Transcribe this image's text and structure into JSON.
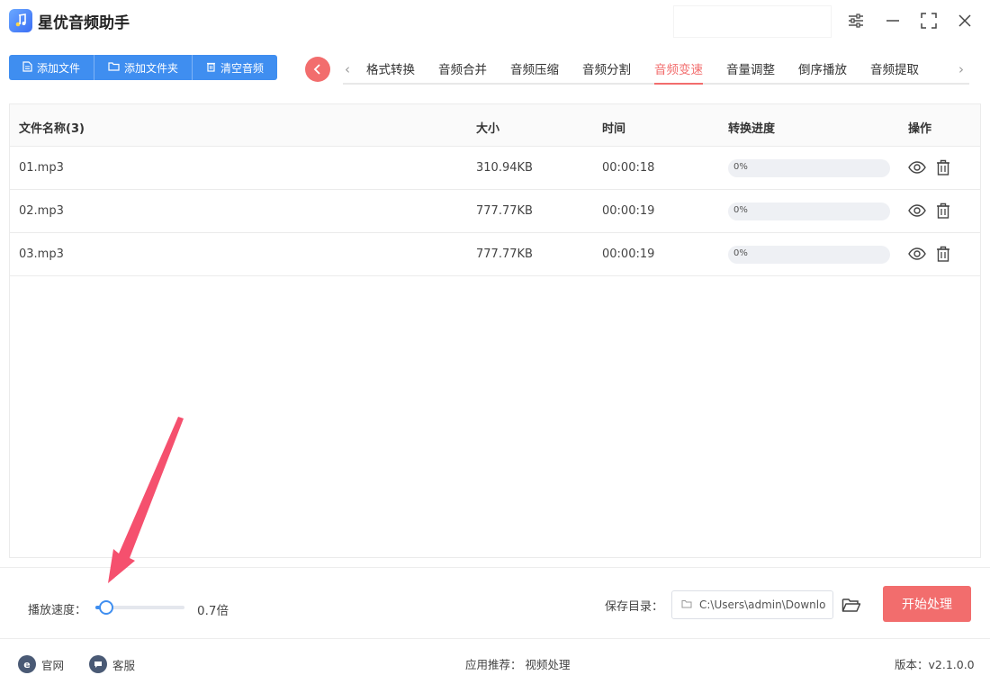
{
  "app": {
    "title": "星优音频助手"
  },
  "toolbar": {
    "add_file": "添加文件",
    "add_folder": "添加文件夹",
    "clear_audio": "清空音频"
  },
  "tabs": [
    {
      "label": "格式转换"
    },
    {
      "label": "音频合并"
    },
    {
      "label": "音频压缩"
    },
    {
      "label": "音频分割"
    },
    {
      "label": "音频变速",
      "active": true
    },
    {
      "label": "音量调整"
    },
    {
      "label": "倒序播放"
    },
    {
      "label": "音频提取"
    }
  ],
  "table": {
    "headers": [
      "文件名称(3)",
      "大小",
      "时间",
      "转换进度",
      "操作"
    ],
    "rows": [
      {
        "name": "01.mp3",
        "size": "310.94KB",
        "time": "00:00:18",
        "progress": "0%",
        "progress_value": 0
      },
      {
        "name": "02.mp3",
        "size": "777.77KB",
        "time": "00:00:19",
        "progress": "0%",
        "progress_value": 0
      },
      {
        "name": "03.mp3",
        "size": "777.77KB",
        "time": "00:00:19",
        "progress": "0%",
        "progress_value": 0
      }
    ]
  },
  "bottom": {
    "speed_label": "播放速度：",
    "speed_value": "0.7倍",
    "speed_fraction": 0.12,
    "save_label": "保存目录：",
    "save_path": "C:\\Users\\admin\\Downlo",
    "start_label": "开始处理"
  },
  "statusbar": {
    "website": "官网",
    "service": "客服",
    "recommend": "应用推荐：  视频处理",
    "version": "版本：v2.1.0.0"
  },
  "colors": {
    "primary": "#3f8ef0",
    "accent": "#f26d6d",
    "annotation_arrow": "#f5506e"
  }
}
